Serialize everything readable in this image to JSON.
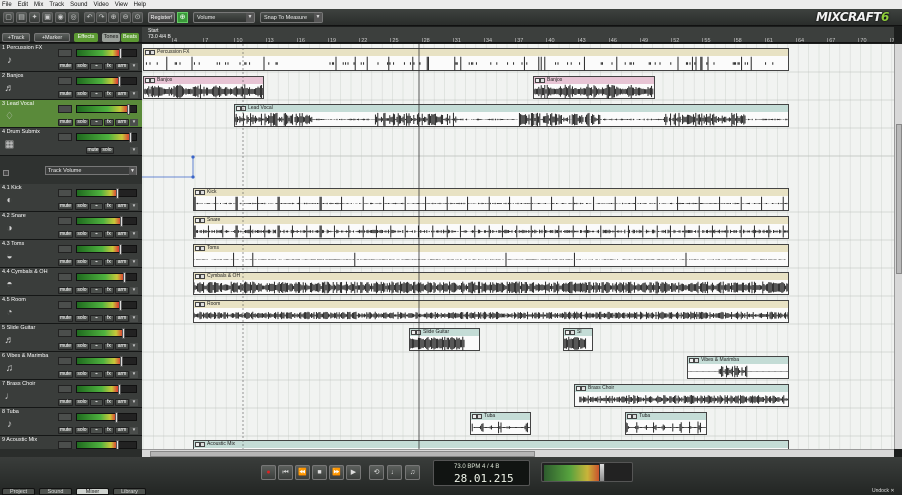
{
  "menu": [
    "File",
    "Edit",
    "Mix",
    "Track",
    "Sound",
    "Video",
    "View",
    "Help"
  ],
  "toolbar": {
    "register_label": "Register!",
    "cart_icon": "cart-icon",
    "volume_dropdown": "Volume",
    "snap_dropdown": "Snap To Measure",
    "logo_text_a": "MIX",
    "logo_text_b": "CRAFT",
    "logo_text_c": "6"
  },
  "left_header": {
    "add_track": "+Track",
    "add_marker": "+Marker",
    "effects": "Effects",
    "tones": "Tones",
    "beats": "Beats"
  },
  "ruler": {
    "start_label": "Start",
    "position": "73.0 4/4 B",
    "labels": [
      "4",
      "7",
      "10",
      "13",
      "16",
      "19",
      "22",
      "25",
      "28",
      "31",
      "34",
      "37",
      "40",
      "43",
      "46",
      "49",
      "52",
      "55",
      "58",
      "61",
      "64",
      "67",
      "70",
      "73"
    ]
  },
  "tracks": [
    {
      "name": "1 Percussion FX",
      "icon": "percussion-icon",
      "mute": "mute",
      "solo": "solo",
      "fx": "fx",
      "arm": "arm",
      "level": 0.72
    },
    {
      "name": "2 Banjos",
      "icon": "guitar-icon",
      "mute": "mute",
      "solo": "solo",
      "fx": "fx",
      "arm": "arm",
      "level": 0.7
    },
    {
      "name": "3 Lead Vocal",
      "icon": "microphone-icon",
      "mute": "mute",
      "solo": "solo",
      "fx": "fx",
      "arm": "arm",
      "level": 0.86
    },
    {
      "name": "4 Drum Submix",
      "icon": "drum-kit-icon",
      "mute": "mute",
      "solo": "solo",
      "fx": "",
      "arm": "",
      "level": 0.9
    },
    {
      "name": "4.1 Kick",
      "icon": "kick-drum-icon",
      "mute": "mute",
      "solo": "solo",
      "fx": "fx",
      "arm": "arm",
      "level": 0.68
    },
    {
      "name": "4.2 Snare",
      "icon": "snare-icon",
      "mute": "mute",
      "solo": "solo",
      "fx": "fx",
      "arm": "arm",
      "level": 0.74
    },
    {
      "name": "4.3 Toms",
      "icon": "toms-icon",
      "mute": "mute",
      "solo": "solo",
      "fx": "fx",
      "arm": "arm",
      "level": 0.72
    },
    {
      "name": "4.4 Cymbals & OH",
      "icon": "cymbal-icon",
      "mute": "mute",
      "solo": "solo",
      "fx": "fx",
      "arm": "arm",
      "level": 0.8
    },
    {
      "name": "4.5 Room",
      "icon": "room-mic-icon",
      "mute": "mute",
      "solo": "solo",
      "fx": "fx",
      "arm": "arm",
      "level": 0.72
    },
    {
      "name": "5 Slide Guitar",
      "icon": "guitar-icon",
      "mute": "mute",
      "solo": "solo",
      "fx": "fx",
      "arm": "arm",
      "level": 0.78
    },
    {
      "name": "6 Vibes & Marimba",
      "icon": "vibes-icon",
      "mute": "mute",
      "solo": "solo",
      "fx": "fx",
      "arm": "arm",
      "level": 0.74
    },
    {
      "name": "7 Brass Choir",
      "icon": "brass-icon",
      "mute": "mute",
      "solo": "solo",
      "fx": "fx",
      "arm": "arm",
      "level": 0.7
    },
    {
      "name": "8 Tuba",
      "icon": "tuba-icon",
      "mute": "mute",
      "solo": "solo",
      "fx": "fx",
      "arm": "arm",
      "level": 0.66
    },
    {
      "name": "9 Acoustic Mix",
      "icon": "acoustic-guitar-icon",
      "mute": "mute",
      "solo": "solo",
      "fx": "fx",
      "arm": "arm",
      "level": 0.68
    }
  ],
  "automation": {
    "select_value": "Track Volume"
  },
  "clips": [
    {
      "label": "Percussion FX",
      "track": 0
    },
    {
      "label": "Banjos",
      "track": 1
    },
    {
      "label": "Banjos",
      "track": 1
    },
    {
      "label": "Lead Vocal",
      "track": 2
    },
    {
      "label": "Kick",
      "track": 4
    },
    {
      "label": "Snare",
      "track": 5
    },
    {
      "label": "Toms",
      "track": 6
    },
    {
      "label": "Cymbals & OH",
      "track": 7
    },
    {
      "label": "Room",
      "track": 8
    },
    {
      "label": "Slide Guitar",
      "track": 9
    },
    {
      "label": "Sl",
      "track": 9
    },
    {
      "label": "Vibes & Marimba",
      "track": 10
    },
    {
      "label": "Brass Choir",
      "track": 11
    },
    {
      "label": "Tuba",
      "track": 12
    },
    {
      "label": "Tuba",
      "track": 12
    },
    {
      "label": "Acoustic Mix",
      "track": 13
    }
  ],
  "transport": {
    "tempo_line": "73.0 BPM  4 / 4  B",
    "time": "28.01.215",
    "record_icon": "record-icon",
    "master_level": 0.66
  },
  "bottom_tabs": [
    "Project",
    "Sound",
    "Mixer",
    "Library"
  ],
  "active_tab": "Mixer",
  "undock_label": "Undock",
  "colors": {
    "selected_track": "#5a8a3a",
    "clip_beige": "#e8e2c4",
    "clip_pink": "#e7c4d4",
    "clip_teal": "#c4dcd6",
    "record_red": "#d22222"
  }
}
